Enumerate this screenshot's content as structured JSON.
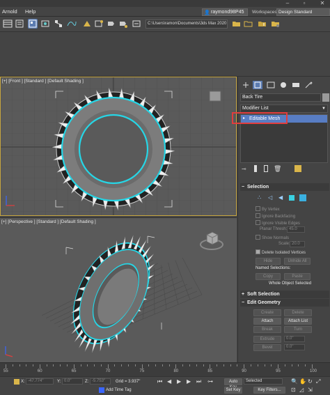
{
  "menubar": {
    "items": [
      "Arnold",
      "Help"
    ],
    "user": "raymond98P45",
    "workspaces_label": "Workspaces:",
    "workspace": "Design Standard"
  },
  "toolbar": {
    "project_path": "C:\\Users\\ramon\\Documents\\3ds Max 2020"
  },
  "viewports": {
    "front_label": "[+] [Front ] [Standard ] [Default Shading ]",
    "persp_label": "[+] [Perspective ] [Standard ] [Default Shading ]"
  },
  "command_panel": {
    "object_name": "Back Tire",
    "modifier_list": "Modifier List",
    "stack_item": "Editable Mesh",
    "selection": {
      "title": "Selection",
      "by_vertex": "By Vertex",
      "ignore_backfacing": "Ignore Backfacing",
      "ignore_visible_edges": "Ignore Visible Edges",
      "planar_thresh_label": "Planar Thresh:",
      "planar_thresh_value": "45.0",
      "show_normals": "Show Normals",
      "scale_label": "Scale:",
      "scale_value": "20.0",
      "delete_isolated": "Delete Isolated Vertices",
      "hide": "Hide",
      "unhide_all": "Unhide All",
      "named_selections": "Named Selections:",
      "copy": "Copy",
      "paste": "Paste",
      "whole_object": "Whole Object Selected"
    },
    "soft_selection": {
      "title": "Soft Selection"
    },
    "edit_geometry": {
      "title": "Edit Geometry",
      "create": "Create",
      "delete": "Delete",
      "attach": "Attach",
      "attach_list": "Attach List",
      "break": "Break",
      "turn": "Turn",
      "extrude_label": "Extrude",
      "extrude_value": "0.0\"",
      "bevel_label": "Bevel",
      "bevel_value": "0.0\""
    }
  },
  "timeline": {
    "ticks": [
      "55",
      "60",
      "65",
      "70",
      "75",
      "80",
      "85",
      "90",
      "95",
      "100"
    ]
  },
  "status": {
    "x_label": "X:",
    "x_value": "-47.774\"",
    "y_label": "Y:",
    "y_value": "0.0\"",
    "z_label": "Z:",
    "z_value": "-5.753\"",
    "grid": "Grid = 3.937\"",
    "add_time_tag": "Add Time Tag",
    "auto_key": "Auto Key",
    "set_key": "Set Key",
    "selected": "Selected",
    "key_filters": "Key Filters..."
  },
  "colors": {
    "selection_accent": "#26d6e6",
    "highlight_red": "#e23d3d",
    "stack_selected": "#587dc4",
    "active_viewport_border": "#c7a640"
  }
}
